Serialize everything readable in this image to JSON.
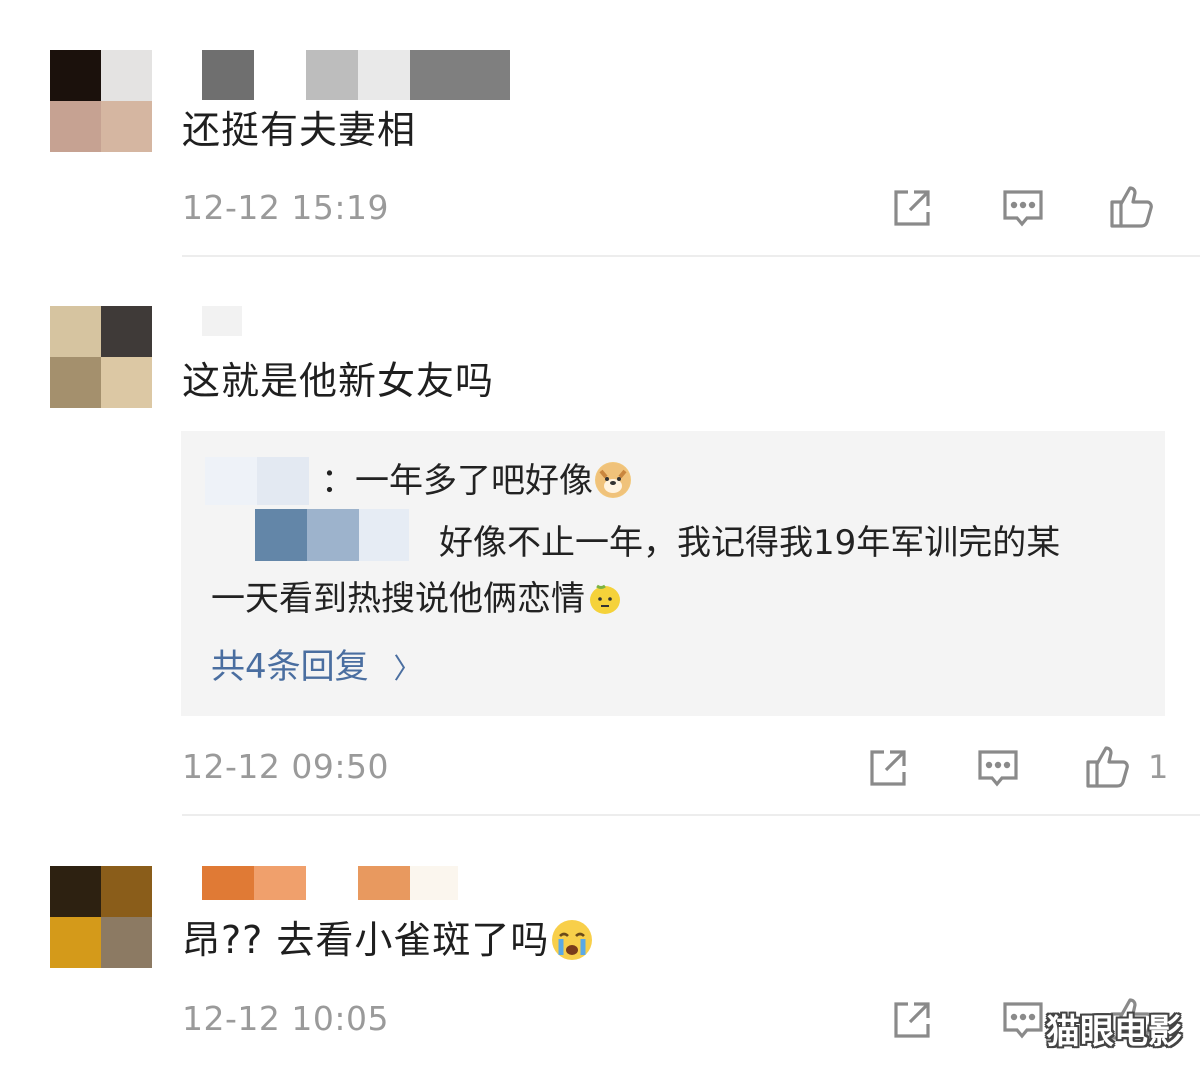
{
  "comments": [
    {
      "text": "还挺有夫妻相",
      "time": "12-12 15:19",
      "like_count": "",
      "avatar_colors": [
        "#1b110c",
        "#e4e3e2",
        "#c6a292",
        "#d5b6a1"
      ],
      "name_blur_colors": [
        "#6f6f6f",
        "#ffffff",
        "#bdbdbd",
        "#e9e9e9",
        "#7f7f7f"
      ]
    },
    {
      "text": "这就是他新女友吗",
      "time": "12-12 09:50",
      "like_count": "1",
      "avatar_colors": [
        "#d6c4a0",
        "#3f3a38",
        "#a4906d",
        "#dcc8a4"
      ],
      "name_blur_colors": [
        "#f2f2f2",
        "#ffffff"
      ],
      "replies": {
        "line1": "：一年多了吧好像",
        "line2": "好像不止一年，我记得我19年军训完的某",
        "line3": "一天看到热搜说他俩恋情",
        "more_label": "共4条回复",
        "more_chevron": "〉",
        "reply_name_blur_colors": [
          "#eef2f8",
          "#e3e9f2"
        ],
        "reply2_name_blur_colors": [
          "#6386a8",
          "#9db3cc",
          "#e6ecf4"
        ]
      }
    },
    {
      "text": "昂?? 去看小雀斑了吗",
      "time": "12-12 10:05",
      "like_count": "",
      "avatar_colors": [
        "#2d2111",
        "#8a5d1a",
        "#d49a1a",
        "#8c7a63"
      ],
      "name_blur_colors": [
        "#e07a35",
        "#f0a06c",
        "#ffffff",
        "#e8995f",
        "#fbf6ee"
      ]
    }
  ],
  "icons": [
    "share-icon",
    "comment-icon",
    "like-icon"
  ],
  "watermark": "猫眼电影",
  "colors": {
    "text": "#1f1f1f",
    "meta": "#9a9a9a",
    "link": "#4a6ea0",
    "reply_bg": "#f4f4f4",
    "divider": "#ededed"
  }
}
